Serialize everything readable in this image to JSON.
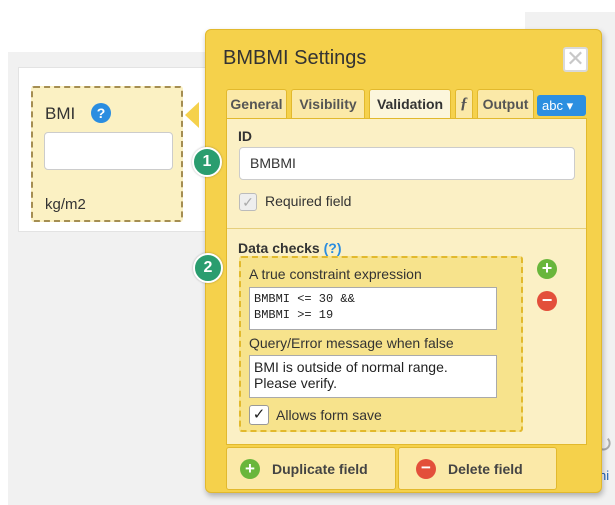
{
  "form_field": {
    "label": "BMI",
    "help_glyph": "?",
    "unit": "kg/m2"
  },
  "background": {
    "right_icon_glyph": "↻",
    "right_text_fragment": "ni"
  },
  "dialog": {
    "title": "BMBMI Settings",
    "close_glyph": "✕",
    "tabs": {
      "general": "General",
      "visibility": "Visibility",
      "validation": "Validation",
      "formula": "ƒ",
      "output": "Output",
      "type_dropdown": "abc ▾"
    },
    "active_tab": "Validation",
    "id": {
      "label": "ID",
      "value": "BMBMI"
    },
    "required": {
      "label": "Required field",
      "checked": true,
      "disabled": true,
      "glyph": "✓"
    },
    "data_checks": {
      "label": "Data checks",
      "help": "(?)",
      "expression_label": "A true constraint expression",
      "expression_value": "BMBMI <= 30 &&\nBMBMI >= 19",
      "message_label": "Query/Error message when false",
      "message_value": "BMI is outside of normal range.\nPlease verify.",
      "allows_save_label": "Allows form save",
      "allows_save_checked": true,
      "allows_save_glyph": "✓",
      "add_glyph": "+",
      "remove_glyph": "−"
    },
    "footer": {
      "duplicate_label": "Duplicate field",
      "delete_label": "Delete field",
      "duplicate_glyph": "+",
      "delete_glyph": "−"
    }
  },
  "callouts": {
    "step_1": "1",
    "step_2": "2"
  },
  "colors": {
    "dialog_yellow": "#f5d14b",
    "panel_cream": "#fbf0c5",
    "accent_blue": "#2a8de0",
    "add_green": "#69b63b",
    "remove_red": "#e34f3a",
    "callout_teal": "#2a9d6f"
  }
}
